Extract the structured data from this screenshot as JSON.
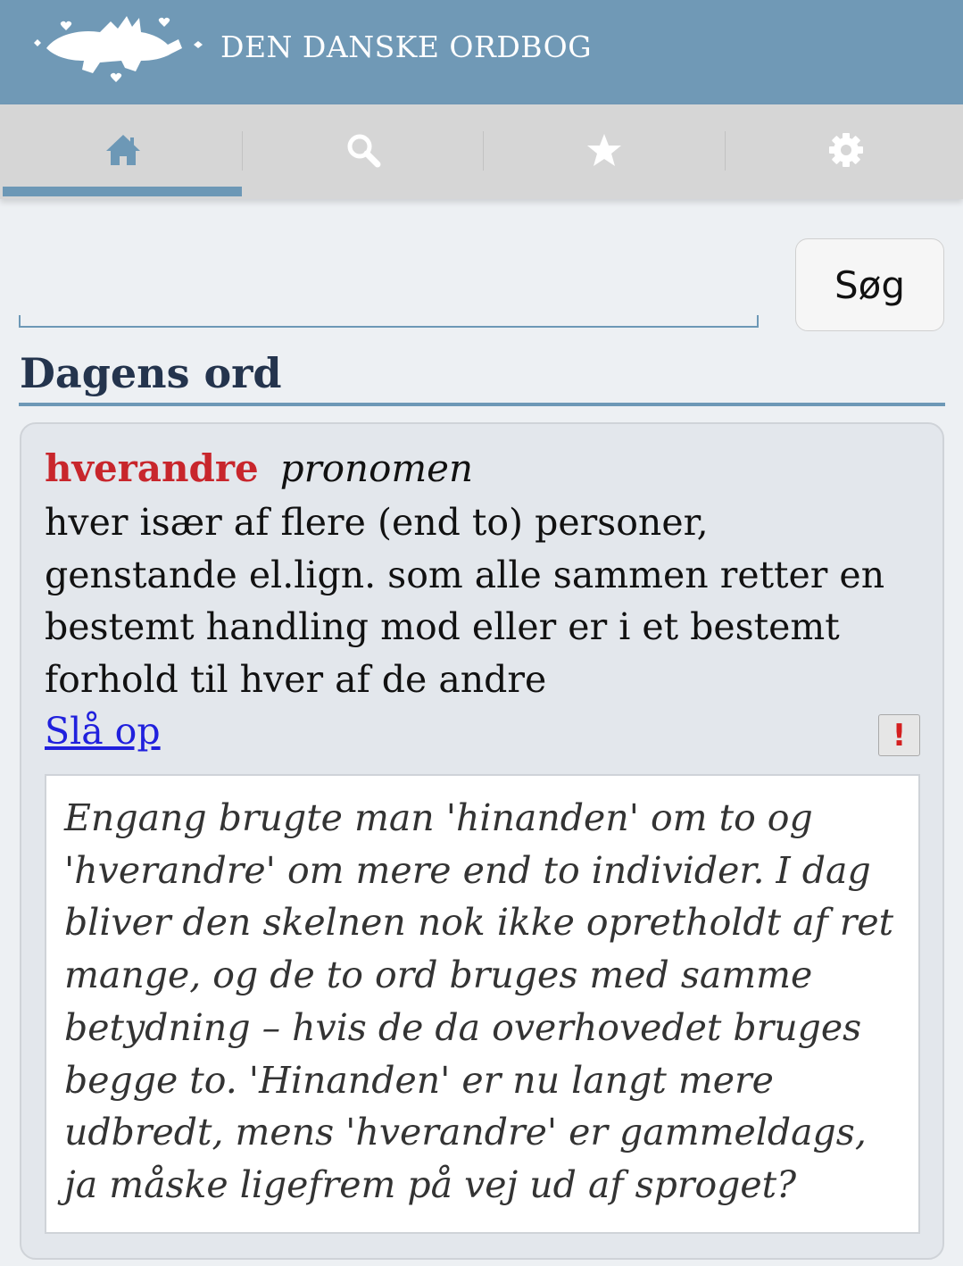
{
  "header": {
    "app_title": "DEN DANSKE ORDBOG",
    "logo_icon": "danish-lions-logo"
  },
  "tabs": [
    {
      "name": "home",
      "icon": "home-icon",
      "active": true
    },
    {
      "name": "search",
      "icon": "search-icon",
      "active": false
    },
    {
      "name": "favorites",
      "icon": "star-icon",
      "active": false
    },
    {
      "name": "settings",
      "icon": "gear-icon",
      "active": false
    }
  ],
  "search": {
    "value": "",
    "placeholder": "",
    "button_label": "Søg"
  },
  "section": {
    "title": "Dagens ord"
  },
  "word_of_day": {
    "headword": "hverandre",
    "word_class": "pronomen",
    "definition": "hver især af flere (end to) personer, genstande el.lign. som alle sammen retter en bestemt handling mod eller er i et bestemt forhold til hver af de andre",
    "lookup_link": "Slå op",
    "report_symbol": "!",
    "note": "Engang brugte man 'hinanden' om to og 'hverandre' om mere end to individer. I dag bliver den skelnen nok ikke opretholdt af ret mange, og de to ord bruges med samme betydning – hvis de da overhovedet bruges begge to. 'Hinanden' er nu langt mere udbredt, mens 'hverandre' er gammeldags, ja måske ligefrem på vej ud af sproget?"
  },
  "colors": {
    "header_bg": "#7099b6",
    "accent": "#6d98b6",
    "headword": "#c8262c",
    "section_title": "#24344d",
    "link": "#2020dd"
  }
}
